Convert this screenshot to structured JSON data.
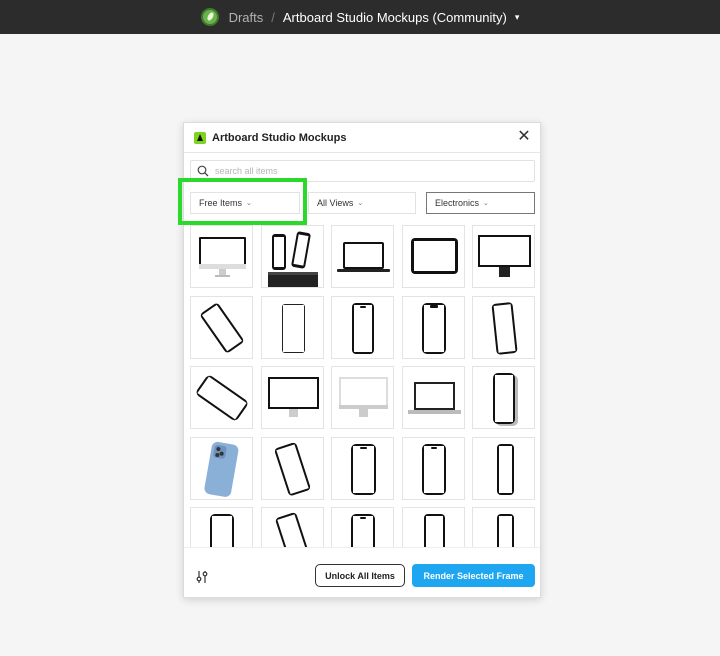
{
  "topbar": {
    "logo_icon": "leaf-logo-icon",
    "breadcrumb_root": "Drafts",
    "separator": "/",
    "file_title": "Artboard Studio Mockups (Community)",
    "chevron": "⌄"
  },
  "plugin": {
    "title": "Artboard Studio Mockups",
    "close_symbol": "✕",
    "search": {
      "placeholder": "search all items",
      "value": ""
    },
    "filters": [
      {
        "label": "Free Items",
        "caret": "⌄",
        "highlighted": true
      },
      {
        "label": "All Views",
        "caret": "⌄"
      },
      {
        "label": "Electronics",
        "caret": "⌄",
        "active": true
      }
    ],
    "items": [
      "desktop-monitor-front",
      "phones-on-stand",
      "laptop-front",
      "tablet-landscape",
      "display-on-stand",
      "phone-tilted-left",
      "phone-front-thin",
      "phone-front",
      "phone-front-notch",
      "phone-angled-right",
      "phone-tilted-landscape",
      "desktop-monitor",
      "desktop-monitor-silver",
      "laptop-silver",
      "phone-front-shadow",
      "phone-back-blue",
      "phone-tilted-right",
      "phone-front-dynamic",
      "phone-front-dynamic-2",
      "phone-side-angle",
      "phone-front-partial",
      "phone-tilted-partial",
      "phone-front-partial-2",
      "phone-front-partial-3",
      "phone-side-partial"
    ],
    "footer": {
      "settings_icon": "sliders-icon",
      "unlock_label": "Unlock All Items",
      "render_label": "Render Selected Frame"
    }
  },
  "colors": {
    "topbar_bg": "#2c2c2c",
    "highlight": "#2bd92b",
    "primary_button": "#1ea7f0",
    "page_bg": "#f5f5f5"
  }
}
